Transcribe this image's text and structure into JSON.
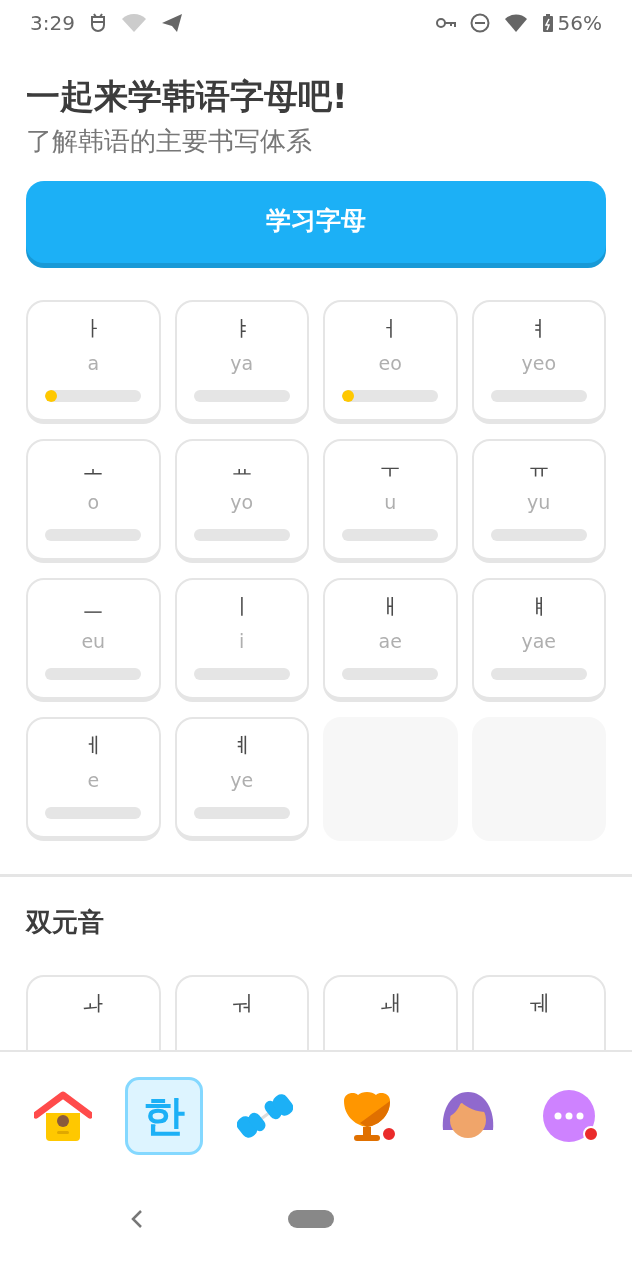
{
  "status_bar": {
    "time": "3:29",
    "battery": "56%"
  },
  "header": {
    "title": "一起来学韩语字母吧!",
    "subtitle": "了解韩语的主要书写体系"
  },
  "learn_button": "学习字母",
  "letters": [
    {
      "kind": "letter",
      "char": "ㅏ",
      "roman": "a",
      "level": 0.05
    },
    {
      "kind": "letter",
      "char": "ㅑ",
      "roman": "ya",
      "level": 0
    },
    {
      "kind": "letter",
      "char": "ㅓ",
      "roman": "eo",
      "level": 0.05
    },
    {
      "kind": "letter",
      "char": "ㅕ",
      "roman": "yeo",
      "level": 0
    },
    {
      "kind": "letter",
      "char": "ㅗ",
      "roman": "o",
      "level": 0
    },
    {
      "kind": "letter",
      "char": "ㅛ",
      "roman": "yo",
      "level": 0
    },
    {
      "kind": "letter",
      "char": "ㅜ",
      "roman": "u",
      "level": 0
    },
    {
      "kind": "letter",
      "char": "ㅠ",
      "roman": "yu",
      "level": 0
    },
    {
      "kind": "letter",
      "char": "ㅡ",
      "roman": "eu",
      "level": 0
    },
    {
      "kind": "letter",
      "char": "ㅣ",
      "roman": "i",
      "level": 0
    },
    {
      "kind": "letter",
      "char": "ㅐ",
      "roman": "ae",
      "level": 0
    },
    {
      "kind": "letter",
      "char": "ㅒ",
      "roman": "yae",
      "level": 0
    },
    {
      "kind": "letter",
      "char": "ㅔ",
      "roman": "e",
      "level": 0
    },
    {
      "kind": "letter",
      "char": "ㅖ",
      "roman": "ye",
      "level": 0
    },
    {
      "kind": "empty"
    },
    {
      "kind": "empty"
    }
  ],
  "diphthongs": {
    "title": "双元音",
    "letters": [
      {
        "char": "ㅘ"
      },
      {
        "char": "ㅝ"
      },
      {
        "char": "ㅙ"
      },
      {
        "char": "ㅞ"
      }
    ]
  },
  "nav": [
    {
      "kind": "home",
      "selected": false,
      "badge": false
    },
    {
      "kind": "letters",
      "label": "한",
      "selected": true,
      "badge": false
    },
    {
      "kind": "practice",
      "selected": false,
      "badge": false
    },
    {
      "kind": "leaderboard",
      "selected": false,
      "badge": true
    },
    {
      "kind": "profile",
      "selected": false,
      "badge": false
    },
    {
      "kind": "more",
      "selected": false,
      "badge": true
    }
  ]
}
